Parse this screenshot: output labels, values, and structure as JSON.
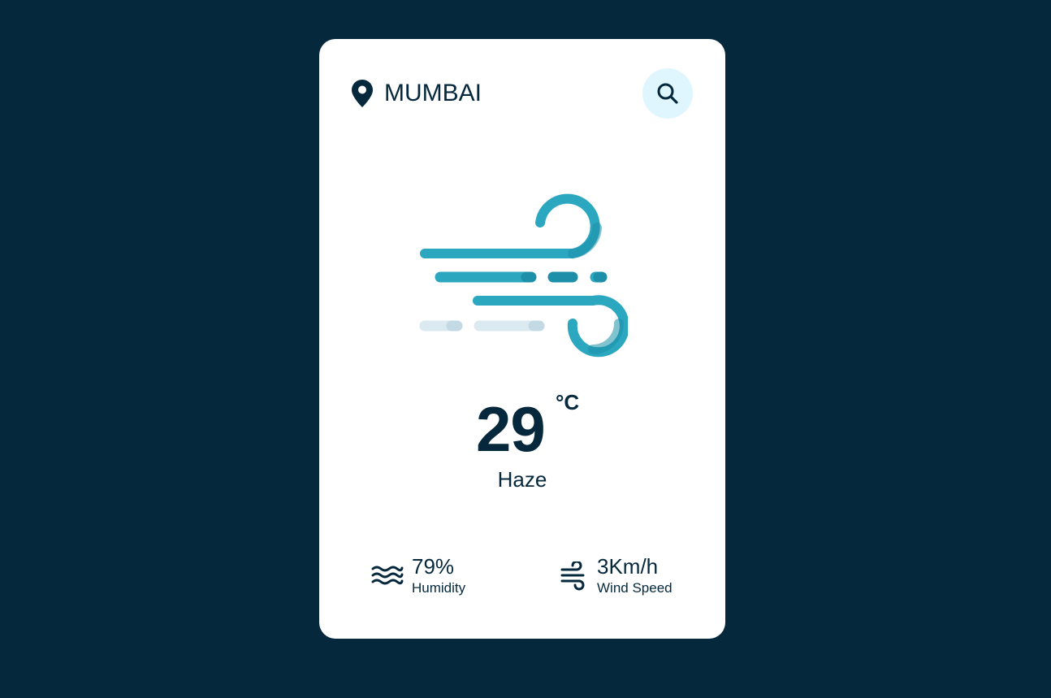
{
  "location": {
    "icon": "map-pin-icon",
    "city": "MUMBAI"
  },
  "search": {
    "icon": "search-icon"
  },
  "weather": {
    "icon": "wind-icon",
    "temperature": "29",
    "unit": "°C",
    "description": "Haze"
  },
  "details": {
    "humidity": {
      "icon": "waves-icon",
      "value": "79%",
      "label": "Humidity"
    },
    "wind": {
      "icon": "wind-icon",
      "value": "3Km/h",
      "label": "Wind Speed"
    }
  },
  "colors": {
    "background": "#06283d",
    "card": "#ffffff",
    "text": "#06283d",
    "accent": "#2ba7c0",
    "search_bg": "#dff6ff"
  }
}
